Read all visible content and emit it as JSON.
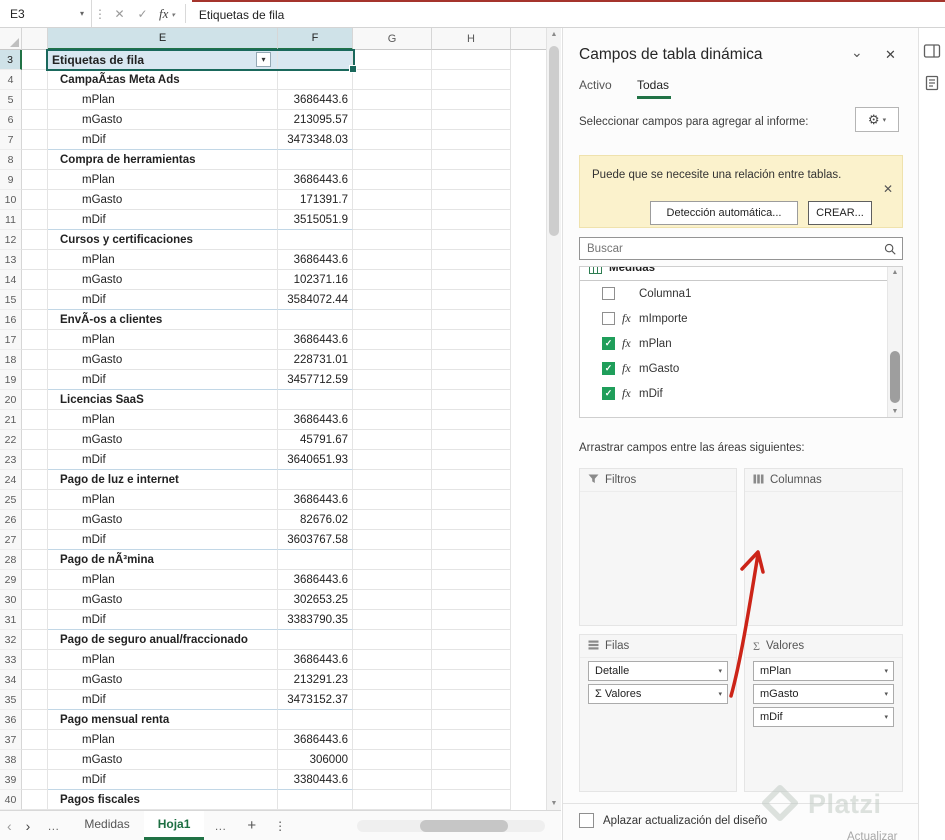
{
  "formula_bar": {
    "cell_ref": "E3",
    "formula": "Etiquetas de fila",
    "fx_label": "fx"
  },
  "icons": {
    "chevron_down": "▾",
    "chevron_small": "⌄",
    "close": "✕",
    "cancel": "✕",
    "enter": "✓",
    "ellipsis": "…",
    "plus": "+",
    "kebab": "⋮",
    "nav_left": "‹",
    "nav_right": "›",
    "up_arrow": "▲",
    "down_arrow": "▼",
    "sigma": "Σ",
    "gear": "⚙",
    "check": "✓"
  },
  "sheet": {
    "columns": [
      {
        "label": "E",
        "selected": true
      },
      {
        "label": "F",
        "selected": true
      },
      {
        "label": "G",
        "selected": false
      },
      {
        "label": "H",
        "selected": false
      }
    ],
    "rows": [
      {
        "num": 3,
        "type": "header",
        "label": "Etiquetas de fila"
      },
      {
        "num": 4,
        "type": "group",
        "label": "CampaÃ±as Meta Ads"
      },
      {
        "num": 5,
        "type": "item",
        "label": "mPlan",
        "value": "3686443.6"
      },
      {
        "num": 6,
        "type": "item",
        "label": "mGasto",
        "value": "213095.57"
      },
      {
        "num": 7,
        "type": "item",
        "label": "mDif",
        "value": "3473348.03",
        "end": true
      },
      {
        "num": 8,
        "type": "group",
        "label": "Compra de herramientas"
      },
      {
        "num": 9,
        "type": "item",
        "label": "mPlan",
        "value": "3686443.6"
      },
      {
        "num": 10,
        "type": "item",
        "label": "mGasto",
        "value": "171391.7"
      },
      {
        "num": 11,
        "type": "item",
        "label": "mDif",
        "value": "3515051.9",
        "end": true
      },
      {
        "num": 12,
        "type": "group",
        "label": "Cursos y certificaciones"
      },
      {
        "num": 13,
        "type": "item",
        "label": "mPlan",
        "value": "3686443.6"
      },
      {
        "num": 14,
        "type": "item",
        "label": "mGasto",
        "value": "102371.16"
      },
      {
        "num": 15,
        "type": "item",
        "label": "mDif",
        "value": "3584072.44",
        "end": true
      },
      {
        "num": 16,
        "type": "group",
        "label": "EnvÃ-os a clientes"
      },
      {
        "num": 17,
        "type": "item",
        "label": "mPlan",
        "value": "3686443.6"
      },
      {
        "num": 18,
        "type": "item",
        "label": "mGasto",
        "value": "228731.01"
      },
      {
        "num": 19,
        "type": "item",
        "label": "mDif",
        "value": "3457712.59",
        "end": true
      },
      {
        "num": 20,
        "type": "group",
        "label": "Licencias SaaS"
      },
      {
        "num": 21,
        "type": "item",
        "label": "mPlan",
        "value": "3686443.6"
      },
      {
        "num": 22,
        "type": "item",
        "label": "mGasto",
        "value": "45791.67"
      },
      {
        "num": 23,
        "type": "item",
        "label": "mDif",
        "value": "3640651.93",
        "end": true
      },
      {
        "num": 24,
        "type": "group",
        "label": "Pago de luz e internet"
      },
      {
        "num": 25,
        "type": "item",
        "label": "mPlan",
        "value": "3686443.6"
      },
      {
        "num": 26,
        "type": "item",
        "label": "mGasto",
        "value": "82676.02"
      },
      {
        "num": 27,
        "type": "item",
        "label": "mDif",
        "value": "3603767.58",
        "end": true
      },
      {
        "num": 28,
        "type": "group",
        "label": "Pago de nÃ³mina"
      },
      {
        "num": 29,
        "type": "item",
        "label": "mPlan",
        "value": "3686443.6"
      },
      {
        "num": 30,
        "type": "item",
        "label": "mGasto",
        "value": "302653.25"
      },
      {
        "num": 31,
        "type": "item",
        "label": "mDif",
        "value": "3383790.35",
        "end": true
      },
      {
        "num": 32,
        "type": "group",
        "label": "Pago de seguro anual/fraccionado"
      },
      {
        "num": 33,
        "type": "item",
        "label": "mPlan",
        "value": "3686443.6"
      },
      {
        "num": 34,
        "type": "item",
        "label": "mGasto",
        "value": "213291.23"
      },
      {
        "num": 35,
        "type": "item",
        "label": "mDif",
        "value": "3473152.37",
        "end": true
      },
      {
        "num": 36,
        "type": "group",
        "label": "Pago mensual renta"
      },
      {
        "num": 37,
        "type": "item",
        "label": "mPlan",
        "value": "3686443.6"
      },
      {
        "num": 38,
        "type": "item",
        "label": "mGasto",
        "value": "306000"
      },
      {
        "num": 39,
        "type": "item",
        "label": "mDif",
        "value": "3380443.6",
        "end": true
      },
      {
        "num": 40,
        "type": "group",
        "label": "Pagos fiscales"
      }
    ],
    "tabs": [
      {
        "label": "Medidas",
        "active": false
      },
      {
        "label": "Hoja1",
        "active": true
      }
    ]
  },
  "panel": {
    "title": "Campos de tabla dinámica",
    "tabs": {
      "activo": "Activo",
      "todas": "Todas"
    },
    "select_hint": "Seleccionar campos para agregar al informe:",
    "banner": {
      "text": "Puede que se necesite una relación entre tablas.",
      "auto_button": "Detección automática...",
      "create_button": "CREAR..."
    },
    "search_placeholder": "Buscar",
    "field_group": "Medidas",
    "fields": [
      {
        "name": "Columna1",
        "checked": false,
        "is_measure": false
      },
      {
        "name": "mImporte",
        "checked": false,
        "is_measure": true
      },
      {
        "name": "mPlan",
        "checked": true,
        "is_measure": true
      },
      {
        "name": "mGasto",
        "checked": true,
        "is_measure": true
      },
      {
        "name": "mDif",
        "checked": true,
        "is_measure": true
      }
    ],
    "drag_hint": "Arrastrar campos entre las áreas siguientes:",
    "areas": {
      "filtros": {
        "label": "Filtros",
        "items": []
      },
      "columnas": {
        "label": "Columnas",
        "items": []
      },
      "filas": {
        "label": "Filas",
        "items": [
          "Detalle",
          "Σ Valores"
        ]
      },
      "valores": {
        "label": "Valores",
        "items": [
          "mPlan",
          "mGasto",
          "mDif"
        ]
      }
    },
    "defer_label": "Aplazar actualización del diseño",
    "update_label": "Actualizar",
    "watermark": "Platzi"
  }
}
